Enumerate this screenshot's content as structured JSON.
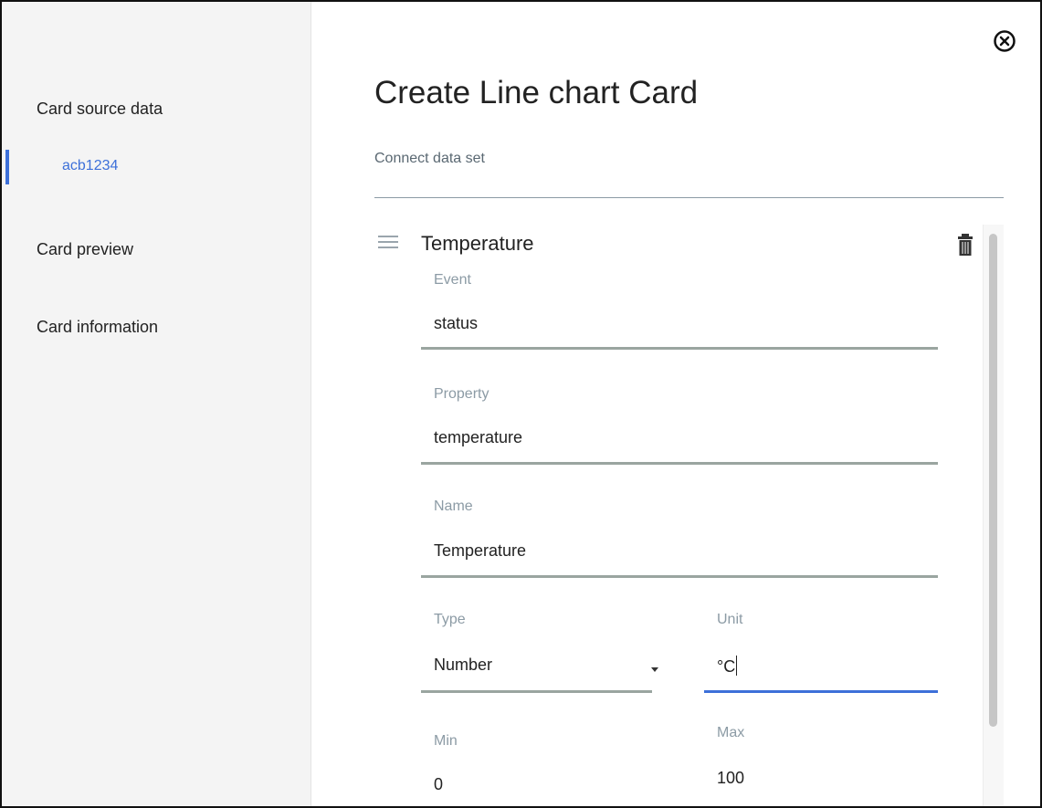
{
  "sidebar": {
    "items": [
      {
        "label": "Card source data"
      },
      {
        "label": "acb1234"
      },
      {
        "label": "Card preview"
      },
      {
        "label": "Card information"
      }
    ],
    "accent": "#3d70d9"
  },
  "dialog": {
    "title": "Create Line chart Card",
    "subtitle": "Connect data set",
    "close_icon": "close-circle-icon"
  },
  "dataset": {
    "title": "Temperature",
    "drag_icon": "drag-handle-icon",
    "delete_icon": "trash-icon",
    "fields": {
      "event": {
        "label": "Event",
        "value": "status"
      },
      "property": {
        "label": "Property",
        "value": "temperature"
      },
      "name": {
        "label": "Name",
        "value": "Temperature"
      },
      "type": {
        "label": "Type",
        "value": "Number"
      },
      "unit": {
        "label": "Unit",
        "value": "°C"
      },
      "min": {
        "label": "Min",
        "value": "0"
      },
      "max": {
        "label": "Max",
        "value": "100"
      }
    }
  },
  "colors": {
    "accent": "#3d70d9",
    "input_underline": "#9aa5a0",
    "label": "#8c9ba5",
    "sidebar_bg": "#f4f4f4"
  }
}
